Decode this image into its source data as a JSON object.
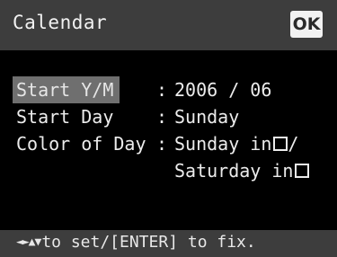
{
  "header": {
    "title": "Calendar",
    "ok_label": "OK"
  },
  "settings": [
    {
      "label": "Start Y/M",
      "separator": ":",
      "value": "2006 / 06",
      "selected": true
    },
    {
      "label": "Start Day",
      "separator": ":",
      "value": "Sunday",
      "selected": false
    },
    {
      "label": "Color of Day",
      "separator": ":",
      "value_line1": "Sunday in",
      "value_line1_suffix": "/",
      "value_line2": "Saturday in",
      "selected": false
    }
  ],
  "footer": {
    "hint_arrows": "◄►▲▼",
    "hint_text": "to set/[ENTER] to fix."
  },
  "colors": {
    "header_bg": "#3d3d3d",
    "selected_bg": "#6f6f6f",
    "background": "#000000",
    "text": "#ececec"
  },
  "icons": [
    "checkbox-icon",
    "arrow-keys-icon"
  ]
}
